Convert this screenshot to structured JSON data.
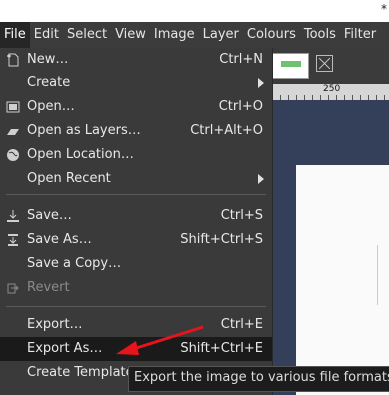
{
  "window": {
    "title_mark": "*"
  },
  "menubar": [
    {
      "label": "File"
    },
    {
      "label": "Edit"
    },
    {
      "label": "Select"
    },
    {
      "label": "View"
    },
    {
      "label": "Image"
    },
    {
      "label": "Layer"
    },
    {
      "label": "Colours"
    },
    {
      "label": "Tools"
    },
    {
      "label": "Filter"
    }
  ],
  "ruler": {
    "mark": "250"
  },
  "file_menu": {
    "new": {
      "label": "New…",
      "shortcut": "Ctrl+N",
      "icon": "new-file-icon"
    },
    "create": {
      "label": "Create"
    },
    "open": {
      "label": "Open…",
      "shortcut": "Ctrl+O",
      "icon": "open-icon"
    },
    "open_layers": {
      "label": "Open as Layers…",
      "shortcut": "Ctrl+Alt+O",
      "icon": "layers-icon"
    },
    "open_location": {
      "label": "Open Location…",
      "icon": "globe-icon"
    },
    "open_recent": {
      "label": "Open Recent"
    },
    "save": {
      "label": "Save…",
      "shortcut": "Ctrl+S",
      "icon": "save-icon"
    },
    "save_as": {
      "label": "Save As…",
      "shortcut": "Shift+Ctrl+S",
      "icon": "save-as-icon"
    },
    "save_copy": {
      "label": "Save a Copy…"
    },
    "revert": {
      "label": "Revert",
      "icon": "revert-icon"
    },
    "export": {
      "label": "Export…",
      "shortcut": "Ctrl+E"
    },
    "export_as": {
      "label": "Export As…",
      "shortcut": "Shift+Ctrl+E"
    },
    "create_template": {
      "label": "Create Template"
    }
  },
  "tooltip": {
    "text": "Export the image to various file formats such"
  },
  "colors": {
    "highlight": "#1a1a1a",
    "arrow": "#e8141c"
  }
}
